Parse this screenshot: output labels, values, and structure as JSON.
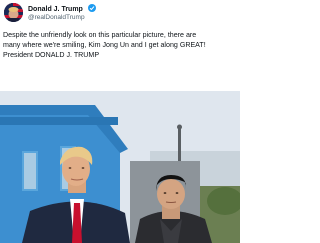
{
  "header": {
    "display_name": "Donald J. Trump",
    "handle": "@realDonaldTrump",
    "verified": true,
    "accent_color": "#e0245e"
  },
  "tweet": {
    "lines": [
      "Despite the unfriendly look on this particular picture, there are",
      "many where we're smiling, Kim Jong Un and I get along GREAT!",
      "President DONALD J. TRUMP"
    ]
  },
  "icons": {
    "avatar": "avatar-flag-image",
    "verified": "verified-badge-icon"
  }
}
